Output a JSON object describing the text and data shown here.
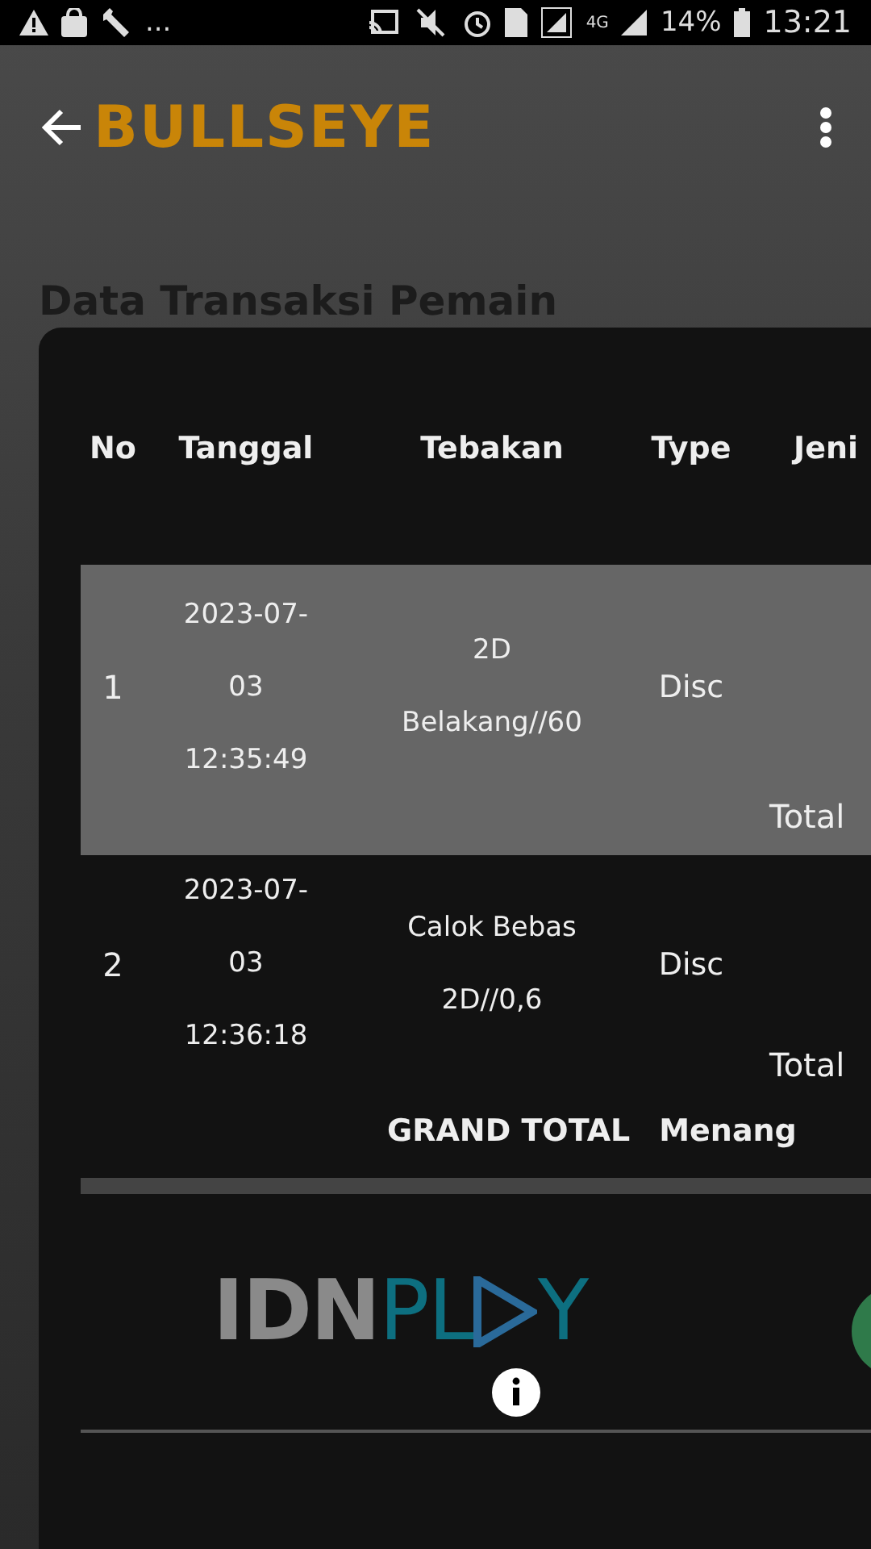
{
  "status_bar": {
    "left_more": "...",
    "network": "4G",
    "battery": "14%",
    "time": "13:21"
  },
  "app_bar": {
    "logo": "BULLSEYE"
  },
  "page_title": "Data Transaksi Pemain",
  "table": {
    "columns": [
      "No",
      "Tanggal",
      "Tebakan",
      "Type",
      "Jeni"
    ],
    "rows": [
      {
        "no": "1",
        "date": "2023-07-03 12:35:49",
        "guess": "2D Belakang//60",
        "type": "Disc",
        "total_label": "Total",
        "selected": true
      },
      {
        "no": "2",
        "date": "2023-07-03 12:36:18",
        "guess": "Calok Bebas 2D//0,6",
        "type": "Disc",
        "total_label": "Total",
        "selected": false
      }
    ],
    "grand_total": {
      "label": "GRAND TOTAL",
      "column_2": "Menang"
    }
  },
  "footer": {
    "logo": {
      "part_1": "IDN",
      "part_2": "PL",
      "part_3": "Y"
    }
  }
}
